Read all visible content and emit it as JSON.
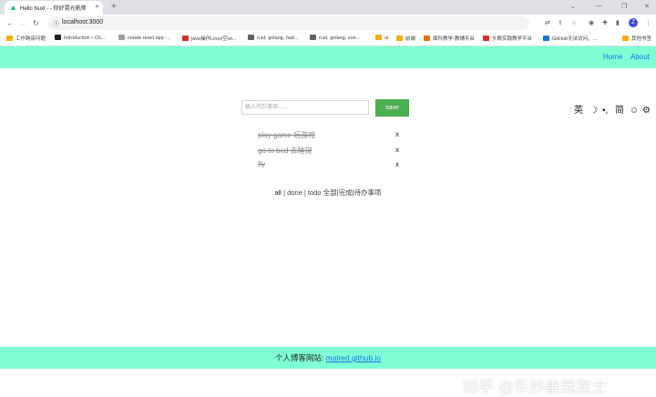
{
  "browser": {
    "tab_title": "Hello Nuxt - - 你好晃光帆帅",
    "url": "localhost:3000",
    "profile_initial": "Z"
  },
  "bookmarks": [
    {
      "label": "工作跨床问题",
      "color": "#f9ab00"
    },
    {
      "label": "Introduction • Ch...",
      "color": "#202124"
    },
    {
      "label": "create react app -...",
      "color": "#9aa0a6"
    },
    {
      "label": "java操作Linux空wi...",
      "color": "#d93025"
    },
    {
      "label": "rust, golang, had...",
      "color": "#5f6368"
    },
    {
      "label": "rust, golang, vue...",
      "color": "#5f6368"
    },
    {
      "label": "ui",
      "color": "#f9ab00"
    },
    {
      "label": "前端",
      "color": "#f9ab00"
    },
    {
      "label": "面科教学-教辅平台",
      "color": "#e37400"
    },
    {
      "label": "头歌实践教学平台",
      "color": "#d93025"
    },
    {
      "label": "GitHub无法访问、...",
      "color": "#1a73e8"
    },
    {
      "label": "其他书签",
      "color": "#f9ab00"
    }
  ],
  "nav": {
    "home": "Home",
    "about": "About"
  },
  "form": {
    "placeholder": "输入代办事项......",
    "save_label": "save"
  },
  "todos": [
    {
      "text": "play game 玩游戏",
      "done": true
    },
    {
      "text": "go to bed 去睡觉",
      "done": true
    },
    {
      "text": "fly",
      "done": true
    }
  ],
  "delete_label": "x",
  "filters": {
    "all": "all",
    "sep1": " | ",
    "done": "done",
    "sep2": " | ",
    "todo": "todo",
    "desc": " 全部|完成|待办事项"
  },
  "ime": {
    "lang": "英",
    "moon": "☽",
    "punct": "•,",
    "simp": "简",
    "emoji": "☺",
    "gear": "⚙"
  },
  "footer": {
    "label": "个人博客网站: ",
    "link": "malred.github.io"
  },
  "watermark": "知乎 @乐妙善哉居士"
}
